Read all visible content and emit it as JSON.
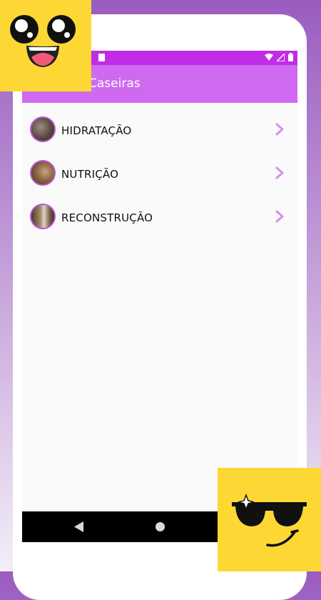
{
  "app_title": "Caseiras",
  "items": [
    {
      "label": "HIDRATAÇÃO",
      "avatar": "hair-photo-avatar"
    },
    {
      "label": "NUTRIÇÃO",
      "avatar": "hair-photo-avatar"
    },
    {
      "label": "RECONSTRUÇÃO",
      "avatar": "hair-photo-avatar"
    }
  ],
  "icons": {
    "chevron": "chevron-right-icon",
    "wifi": "wifi-icon",
    "signal": "signal-icon",
    "battery": "battery-icon",
    "sd_card": "sd-card-icon",
    "back": "back-icon",
    "home": "home-icon"
  },
  "colors": {
    "status_bar": "#c02de6",
    "app_bar": "#cf6af0",
    "chevron": "#d48ef0",
    "sticker": "#fdd835"
  }
}
